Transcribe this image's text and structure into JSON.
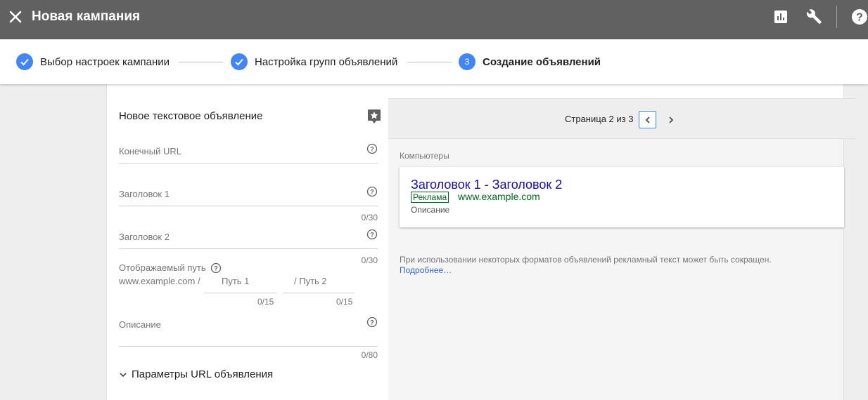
{
  "header": {
    "title": "Новая кампания",
    "colors": {
      "bar": "#616161",
      "accent": "#4285f4"
    }
  },
  "stepper": {
    "steps": [
      {
        "label": "Выбор настроек кампании",
        "state": "done"
      },
      {
        "label": "Настройка групп объявлений",
        "state": "done"
      },
      {
        "number": "3",
        "label": "Создание объявлений",
        "state": "active"
      }
    ]
  },
  "form": {
    "title": "Новое текстовое объявление",
    "final_url": {
      "label": "Конечный URL"
    },
    "headline1": {
      "label": "Заголовок 1",
      "counter": "0/30"
    },
    "headline2": {
      "label": "Заголовок 2",
      "counter": "0/30"
    },
    "display_path": {
      "label": "Отображаемый путь",
      "domain_prefix": "www.example.com /",
      "path1": "Путь 1",
      "sep": "/",
      "path2": "Путь 2",
      "counter1": "0/15",
      "counter2": "0/15"
    },
    "description": {
      "label": "Описание",
      "counter": "0/80"
    },
    "url_options": "Параметры URL объявления"
  },
  "preview": {
    "pager": "Страница 2 из 3",
    "device": "Компьютеры",
    "ad": {
      "headline": "Заголовок 1 - Заголовок 2",
      "badge": "Реклама",
      "url": "www.example.com",
      "description": "Описание"
    },
    "notice": "При использовании некоторых форматов объявлений рекламный текст может быть сокращен.",
    "more_link": "Подробнее…"
  }
}
